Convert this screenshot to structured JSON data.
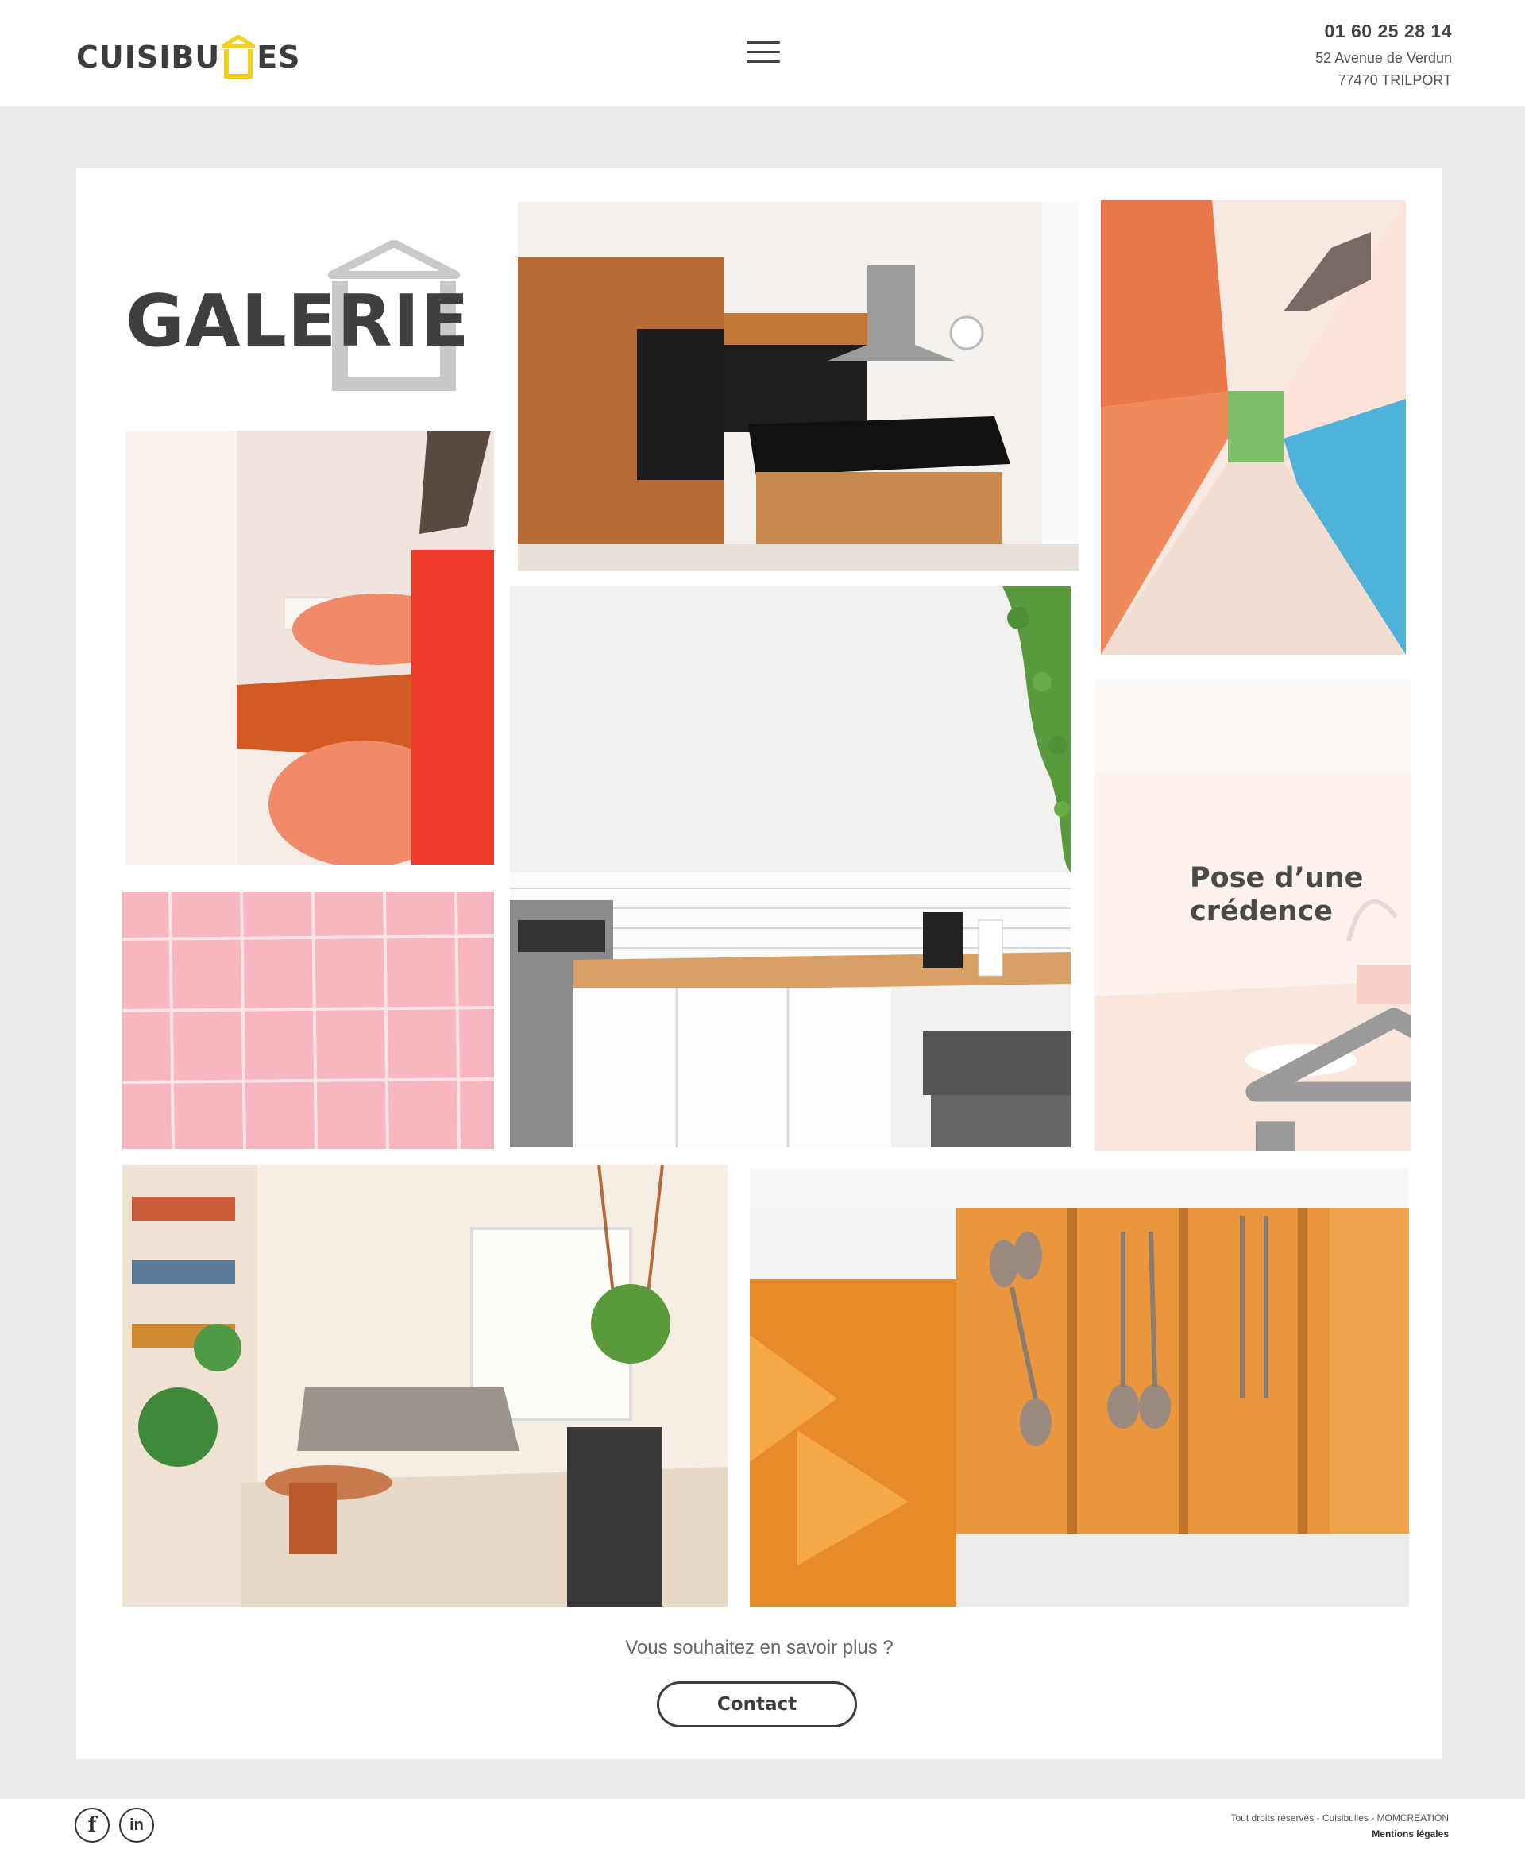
{
  "header": {
    "logo_text_left": "CUISIBU",
    "logo_text_right": "ES",
    "phone": "01 60 25 28 14",
    "address_line1": "52 Avenue de Verdun",
    "address_line2": "77470 TRILPORT"
  },
  "gallery": {
    "title": "GALERIE",
    "overlay_caption_line1": "Pose d’une",
    "overlay_caption_line2": "crédence"
  },
  "cta": {
    "question": "Vous souhaitez en savoir plus ?",
    "button_label": "Contact"
  },
  "footer": {
    "social": [
      {
        "name": "facebook-icon",
        "glyph": "f"
      },
      {
        "name": "linkedin-icon",
        "glyph": "in"
      }
    ],
    "copyright": "Tout droits réservés - Cuisibulles - MOMCREATION",
    "legal_link": "Mentions légales"
  },
  "colors": {
    "brand_yellow": "#f2d11c",
    "text_dark": "#3d3d3d",
    "page_bg": "#ebebeb"
  }
}
